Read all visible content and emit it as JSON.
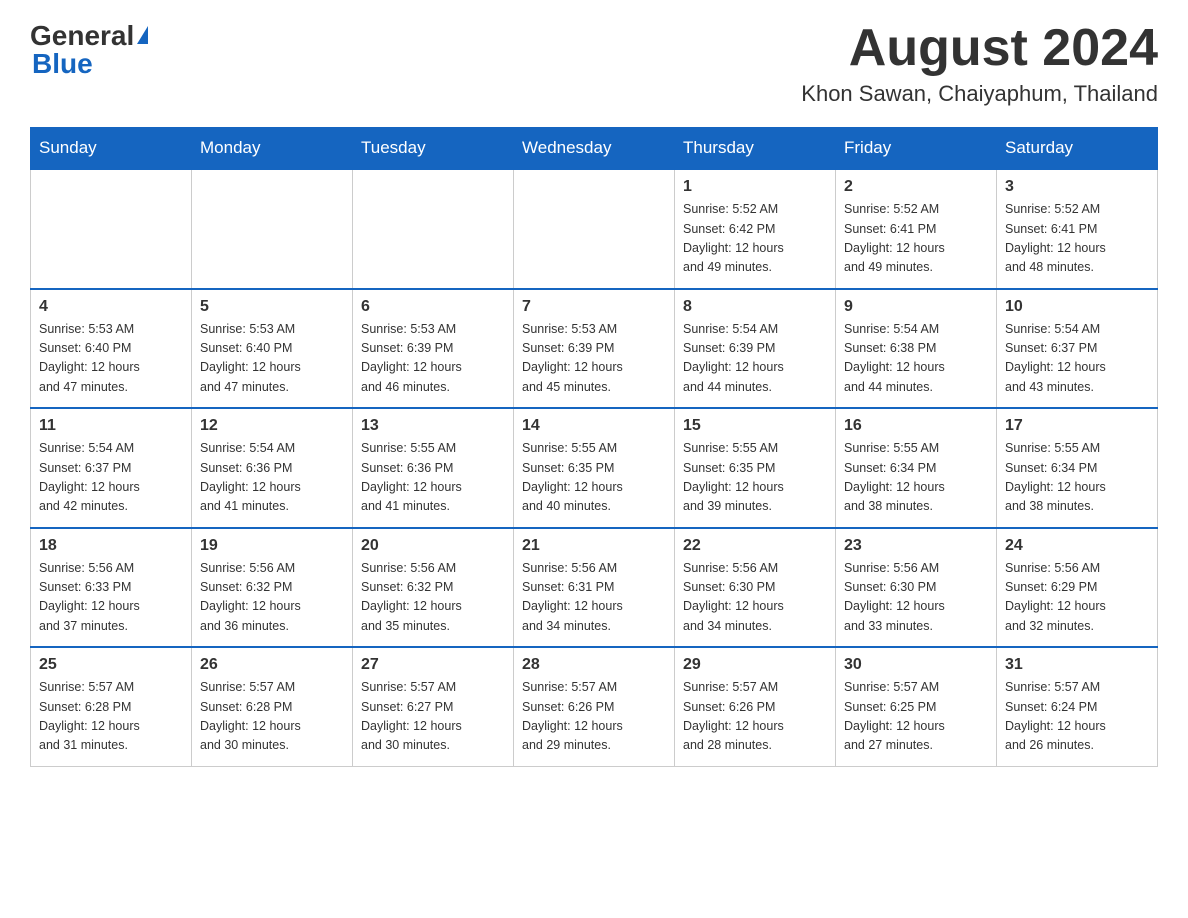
{
  "header": {
    "logo_general": "General",
    "logo_blue": "Blue",
    "month_title": "August 2024",
    "location": "Khon Sawan, Chaiyaphum, Thailand"
  },
  "days_of_week": [
    "Sunday",
    "Monday",
    "Tuesday",
    "Wednesday",
    "Thursday",
    "Friday",
    "Saturday"
  ],
  "weeks": [
    [
      {
        "day": "",
        "info": ""
      },
      {
        "day": "",
        "info": ""
      },
      {
        "day": "",
        "info": ""
      },
      {
        "day": "",
        "info": ""
      },
      {
        "day": "1",
        "info": "Sunrise: 5:52 AM\nSunset: 6:42 PM\nDaylight: 12 hours\nand 49 minutes."
      },
      {
        "day": "2",
        "info": "Sunrise: 5:52 AM\nSunset: 6:41 PM\nDaylight: 12 hours\nand 49 minutes."
      },
      {
        "day": "3",
        "info": "Sunrise: 5:52 AM\nSunset: 6:41 PM\nDaylight: 12 hours\nand 48 minutes."
      }
    ],
    [
      {
        "day": "4",
        "info": "Sunrise: 5:53 AM\nSunset: 6:40 PM\nDaylight: 12 hours\nand 47 minutes."
      },
      {
        "day": "5",
        "info": "Sunrise: 5:53 AM\nSunset: 6:40 PM\nDaylight: 12 hours\nand 47 minutes."
      },
      {
        "day": "6",
        "info": "Sunrise: 5:53 AM\nSunset: 6:39 PM\nDaylight: 12 hours\nand 46 minutes."
      },
      {
        "day": "7",
        "info": "Sunrise: 5:53 AM\nSunset: 6:39 PM\nDaylight: 12 hours\nand 45 minutes."
      },
      {
        "day": "8",
        "info": "Sunrise: 5:54 AM\nSunset: 6:39 PM\nDaylight: 12 hours\nand 44 minutes."
      },
      {
        "day": "9",
        "info": "Sunrise: 5:54 AM\nSunset: 6:38 PM\nDaylight: 12 hours\nand 44 minutes."
      },
      {
        "day": "10",
        "info": "Sunrise: 5:54 AM\nSunset: 6:37 PM\nDaylight: 12 hours\nand 43 minutes."
      }
    ],
    [
      {
        "day": "11",
        "info": "Sunrise: 5:54 AM\nSunset: 6:37 PM\nDaylight: 12 hours\nand 42 minutes."
      },
      {
        "day": "12",
        "info": "Sunrise: 5:54 AM\nSunset: 6:36 PM\nDaylight: 12 hours\nand 41 minutes."
      },
      {
        "day": "13",
        "info": "Sunrise: 5:55 AM\nSunset: 6:36 PM\nDaylight: 12 hours\nand 41 minutes."
      },
      {
        "day": "14",
        "info": "Sunrise: 5:55 AM\nSunset: 6:35 PM\nDaylight: 12 hours\nand 40 minutes."
      },
      {
        "day": "15",
        "info": "Sunrise: 5:55 AM\nSunset: 6:35 PM\nDaylight: 12 hours\nand 39 minutes."
      },
      {
        "day": "16",
        "info": "Sunrise: 5:55 AM\nSunset: 6:34 PM\nDaylight: 12 hours\nand 38 minutes."
      },
      {
        "day": "17",
        "info": "Sunrise: 5:55 AM\nSunset: 6:34 PM\nDaylight: 12 hours\nand 38 minutes."
      }
    ],
    [
      {
        "day": "18",
        "info": "Sunrise: 5:56 AM\nSunset: 6:33 PM\nDaylight: 12 hours\nand 37 minutes."
      },
      {
        "day": "19",
        "info": "Sunrise: 5:56 AM\nSunset: 6:32 PM\nDaylight: 12 hours\nand 36 minutes."
      },
      {
        "day": "20",
        "info": "Sunrise: 5:56 AM\nSunset: 6:32 PM\nDaylight: 12 hours\nand 35 minutes."
      },
      {
        "day": "21",
        "info": "Sunrise: 5:56 AM\nSunset: 6:31 PM\nDaylight: 12 hours\nand 34 minutes."
      },
      {
        "day": "22",
        "info": "Sunrise: 5:56 AM\nSunset: 6:30 PM\nDaylight: 12 hours\nand 34 minutes."
      },
      {
        "day": "23",
        "info": "Sunrise: 5:56 AM\nSunset: 6:30 PM\nDaylight: 12 hours\nand 33 minutes."
      },
      {
        "day": "24",
        "info": "Sunrise: 5:56 AM\nSunset: 6:29 PM\nDaylight: 12 hours\nand 32 minutes."
      }
    ],
    [
      {
        "day": "25",
        "info": "Sunrise: 5:57 AM\nSunset: 6:28 PM\nDaylight: 12 hours\nand 31 minutes."
      },
      {
        "day": "26",
        "info": "Sunrise: 5:57 AM\nSunset: 6:28 PM\nDaylight: 12 hours\nand 30 minutes."
      },
      {
        "day": "27",
        "info": "Sunrise: 5:57 AM\nSunset: 6:27 PM\nDaylight: 12 hours\nand 30 minutes."
      },
      {
        "day": "28",
        "info": "Sunrise: 5:57 AM\nSunset: 6:26 PM\nDaylight: 12 hours\nand 29 minutes."
      },
      {
        "day": "29",
        "info": "Sunrise: 5:57 AM\nSunset: 6:26 PM\nDaylight: 12 hours\nand 28 minutes."
      },
      {
        "day": "30",
        "info": "Sunrise: 5:57 AM\nSunset: 6:25 PM\nDaylight: 12 hours\nand 27 minutes."
      },
      {
        "day": "31",
        "info": "Sunrise: 5:57 AM\nSunset: 6:24 PM\nDaylight: 12 hours\nand 26 minutes."
      }
    ]
  ]
}
